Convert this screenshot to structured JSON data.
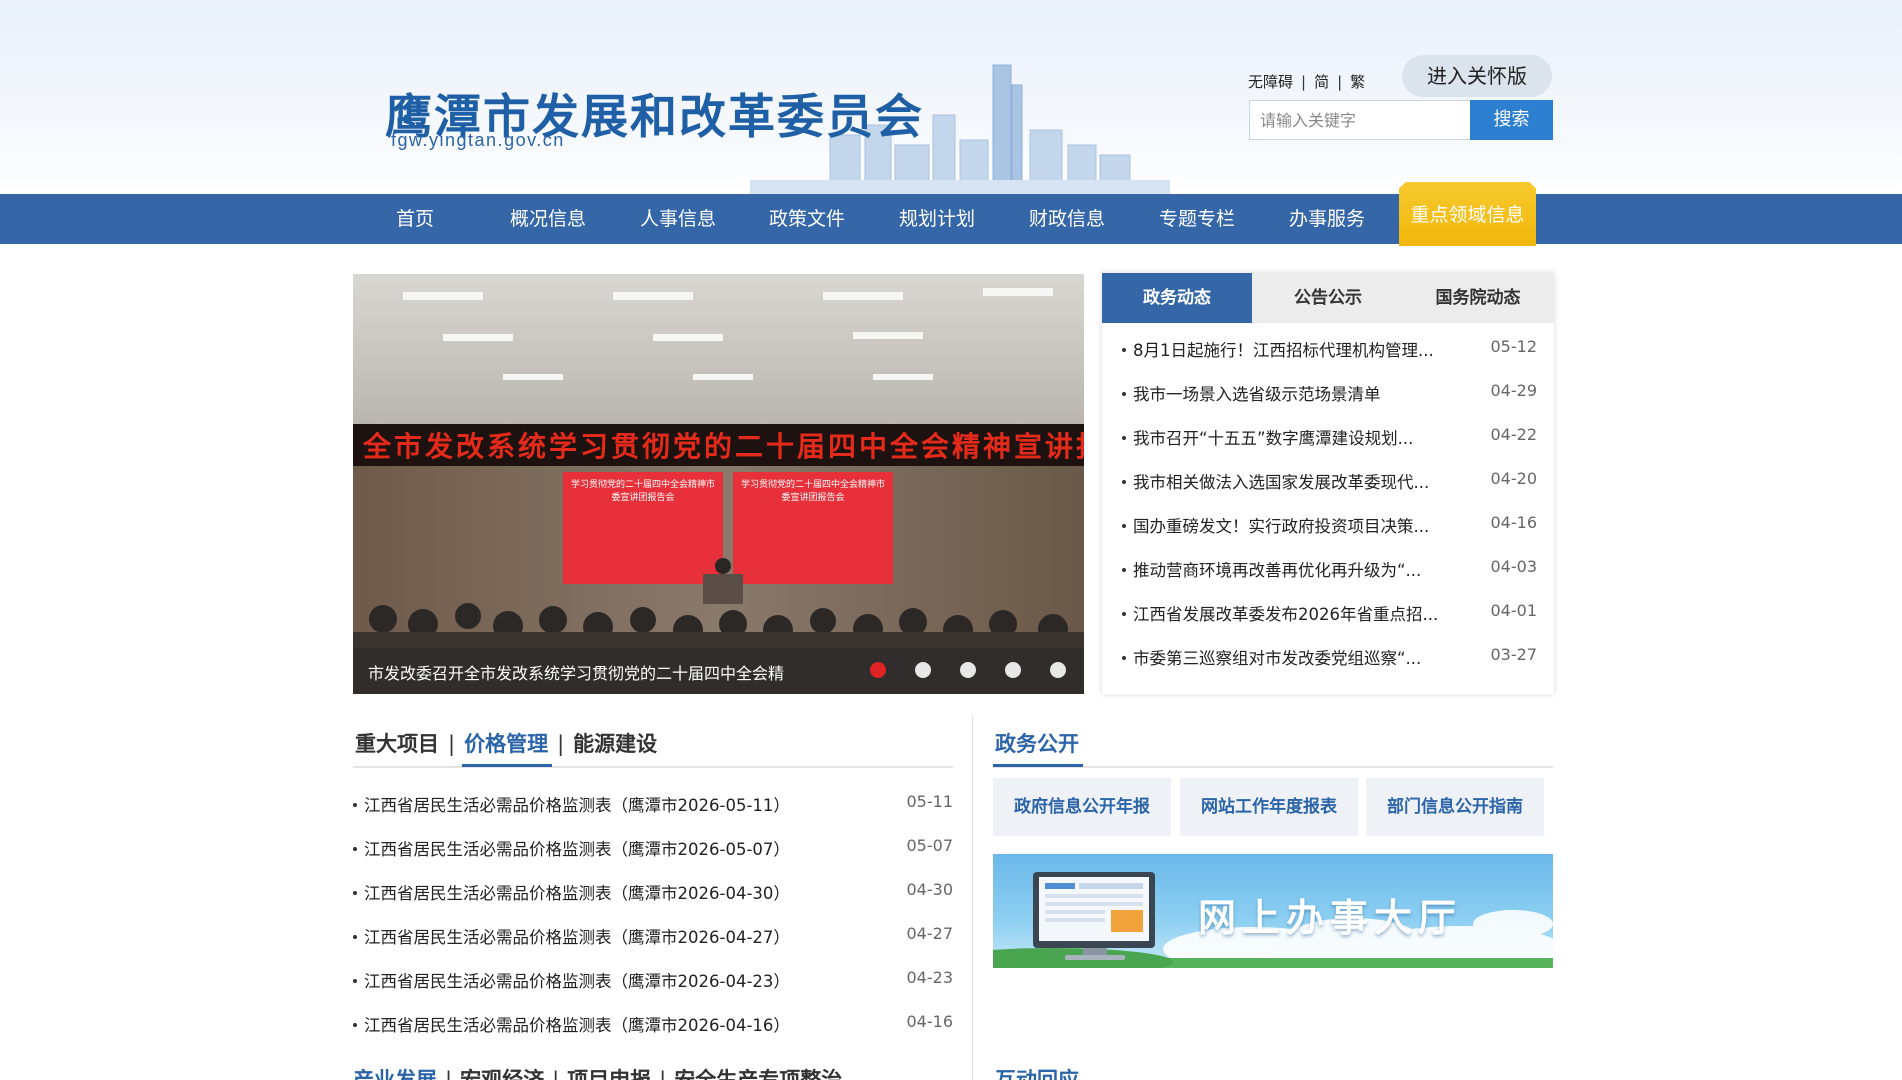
{
  "header": {
    "title": "鹰潭市发展和改革委员会",
    "url": "fgw.yingtan.gov.cn",
    "util_links": [
      "无障碍",
      "简",
      "繁"
    ],
    "care_button": "进入关怀版",
    "search_placeholder": "请输入关键字",
    "search_button": "搜索"
  },
  "nav": {
    "items": [
      "首页",
      "概况信息",
      "人事信息",
      "政策文件",
      "规划计划",
      "财政信息",
      "专题专栏",
      "办事服务",
      "重点领域信息"
    ]
  },
  "carousel": {
    "caption": "市发改委召开全市发改系统学习贯彻党的二十届四中全会精",
    "banner_text": "全市发改系统学习贯彻党的二十届四中全会精神宣讲报告会",
    "screen_text": "学习贯彻党的二十届四中全会精神市委宣讲团报告会",
    "active_index": 0,
    "dot_count": 5
  },
  "news": {
    "tabs": [
      "政务动态",
      "公告公示",
      "国务院动态"
    ],
    "active_tab": 0,
    "items": [
      {
        "title": "8月1日起施行！江西招标代理机构管理...",
        "date": "05-12"
      },
      {
        "title": "我市一场景入选省级示范场景清单",
        "date": "04-29"
      },
      {
        "title": "我市召开“十五五”数字鹰潭建设规划...",
        "date": "04-22"
      },
      {
        "title": "我市相关做法入选国家发展改革委现代...",
        "date": "04-20"
      },
      {
        "title": "国办重磅发文！实行政府投资项目决策...",
        "date": "04-16"
      },
      {
        "title": "推动营商环境再改善再优化再升级为“...",
        "date": "04-03"
      },
      {
        "title": "江西省发展改革委发布2026年省重点招...",
        "date": "04-01"
      },
      {
        "title": "市委第三巡察组对市发改委党组巡察“...",
        "date": "03-27"
      }
    ]
  },
  "price": {
    "tabs": [
      "重大项目",
      "价格管理",
      "能源建设"
    ],
    "active_tab": 1,
    "items": [
      {
        "title": "江西省居民生活必需品价格监测表（鹰潭市2026-05-11）",
        "date": "05-11"
      },
      {
        "title": "江西省居民生活必需品价格监测表（鹰潭市2026-05-07）",
        "date": "05-07"
      },
      {
        "title": "江西省居民生活必需品价格监测表（鹰潭市2026-04-30）",
        "date": "04-30"
      },
      {
        "title": "江西省居民生活必需品价格监测表（鹰潭市2026-04-27）",
        "date": "04-27"
      },
      {
        "title": "江西省居民生活必需品价格监测表（鹰潭市2026-04-23）",
        "date": "04-23"
      },
      {
        "title": "江西省居民生活必需品价格监测表（鹰潭市2026-04-16）",
        "date": "04-16"
      }
    ]
  },
  "gov": {
    "title": "政务公开",
    "buttons": [
      "政府信息公开年报",
      "网站工作年度报表",
      "部门信息公开指南"
    ],
    "banner": "网上办事大厅"
  },
  "bottom": {
    "tabs": [
      "产业发展",
      "宏观经济",
      "项目申报",
      "安全生产专项整治"
    ],
    "right_title": "互动回应"
  },
  "colors": {
    "nav_bg": "#3466a8",
    "accent": "#2b64a8",
    "highlight": "#f2b70a",
    "search_btn": "#2d7fd1",
    "active_dot": "#e02424"
  }
}
